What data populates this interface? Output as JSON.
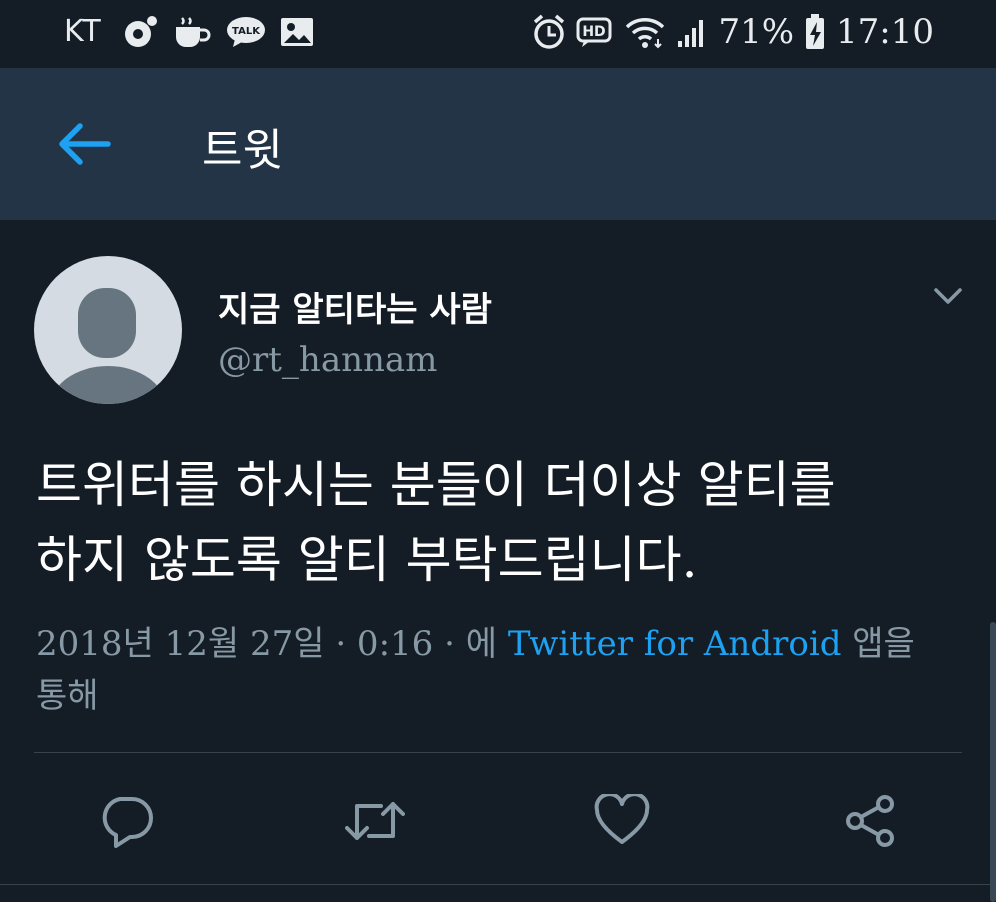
{
  "status_bar": {
    "carrier": "KT",
    "battery": "71%",
    "time": "17:10",
    "left_icons": [
      "record-icon",
      "coffee-icon",
      "talk-icon",
      "image-icon"
    ],
    "talk_badge": "TALK",
    "hd_badge": "HD",
    "right_icons": [
      "alarm-icon",
      "hd-voice-icon",
      "wifi-icon",
      "signal-icon",
      "battery-charging-icon"
    ]
  },
  "toolbar": {
    "title": "트윗",
    "back_icon": "arrow-left-icon"
  },
  "tweet": {
    "display_name": "지금 알티타는 사람",
    "handle": "@rt_hannam",
    "text_line1": "트위터를 하시는 분들이 더이상 알티를",
    "text_line2": "하지 않도록 알티 부탁드립니다.",
    "timestamp": "2018년 12월 27일 · 0:16 · 에",
    "source": "Twitter for Android",
    "source_suffix": "앱을 통해"
  },
  "actions": [
    "reply-icon",
    "retweet-icon",
    "like-icon",
    "share-icon"
  ],
  "colors": {
    "background": "#141d26",
    "toolbar": "#243447",
    "accent": "#1da1f2",
    "secondary_text": "#8899a6",
    "divider": "#38444d"
  }
}
